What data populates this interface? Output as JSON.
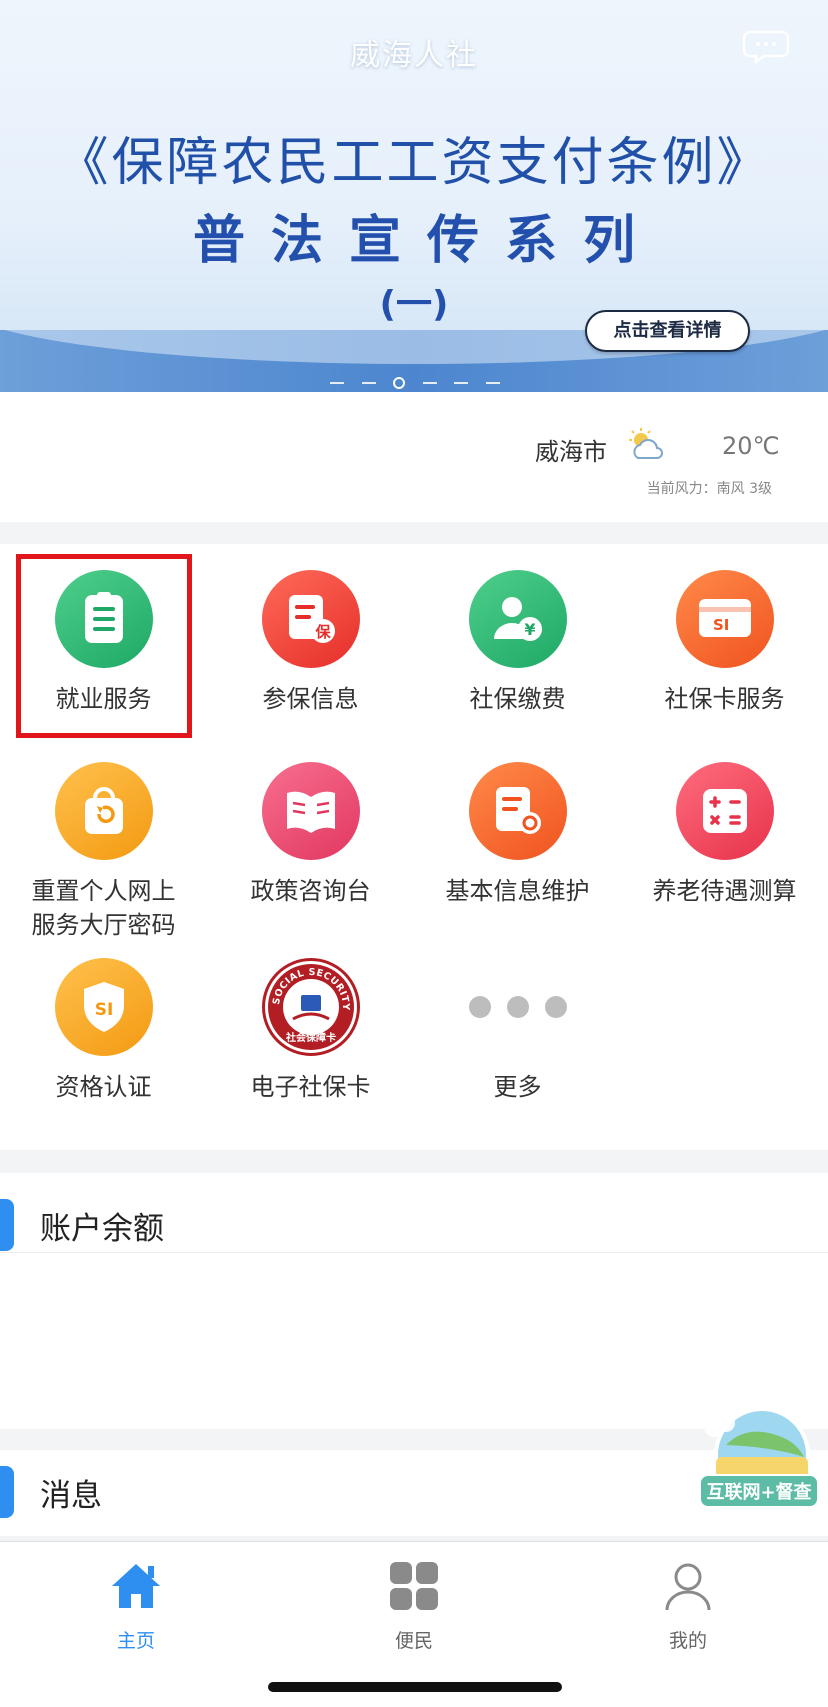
{
  "banner": {
    "app_title": "威海人社",
    "headline": "《保障农民工工资支付条例》",
    "subline": "普法宣传系列",
    "paren": "(一)",
    "detail_button": "点击查看详情",
    "message_icon": "chat-bubble-icon"
  },
  "weather": {
    "city": "威海市",
    "temperature": "20℃",
    "wind": "当前风力：南风 3级",
    "icon": "partly-cloudy-icon"
  },
  "services": [
    {
      "label": "就业服务",
      "icon": "document-icon",
      "color": "#1ea865"
    },
    {
      "label": "参保信息",
      "icon": "insurance-doc-icon",
      "color": "#e52e29"
    },
    {
      "label": "社保缴费",
      "icon": "person-yen-icon",
      "color": "#1ea865"
    },
    {
      "label": "社保卡服务",
      "icon": "si-card-icon",
      "color": "#f0531f"
    },
    {
      "label": "重置个人网上",
      "label2": "服务大厅密码",
      "icon": "reset-bag-icon",
      "color": "#f39a12"
    },
    {
      "label": "政策咨询台",
      "icon": "open-book-icon",
      "color": "#e23760"
    },
    {
      "label": "基本信息维护",
      "icon": "doc-gear-icon",
      "color": "#f0531f"
    },
    {
      "label": "养老待遇测算",
      "icon": "calculator-icon",
      "color": "#e7324b"
    },
    {
      "label": "资格认证",
      "icon": "si-shield-icon",
      "color": "#f39a12"
    },
    {
      "label": "电子社保卡",
      "icon": "social-security-card-logo",
      "color": "#b21e24"
    },
    {
      "label": "更多",
      "icon": "more-dots-icon",
      "color": "#bdbdbd"
    }
  ],
  "card_logo": {
    "ring_text": "SOCIAL SECURITY CARD",
    "inner_text": "社会保障卡"
  },
  "balance": {
    "title": "账户余额"
  },
  "messages": {
    "title": "消息"
  },
  "float_badge": {
    "label": "互联网+督查"
  },
  "tabbar": {
    "items": [
      {
        "label": "主页",
        "icon": "home-icon",
        "active": true
      },
      {
        "label": "便民",
        "icon": "grid-icon",
        "active": false
      },
      {
        "label": "我的",
        "icon": "person-icon",
        "active": false
      }
    ],
    "active_color": "#2f8ff0"
  },
  "highlight_color": "#e1161b"
}
